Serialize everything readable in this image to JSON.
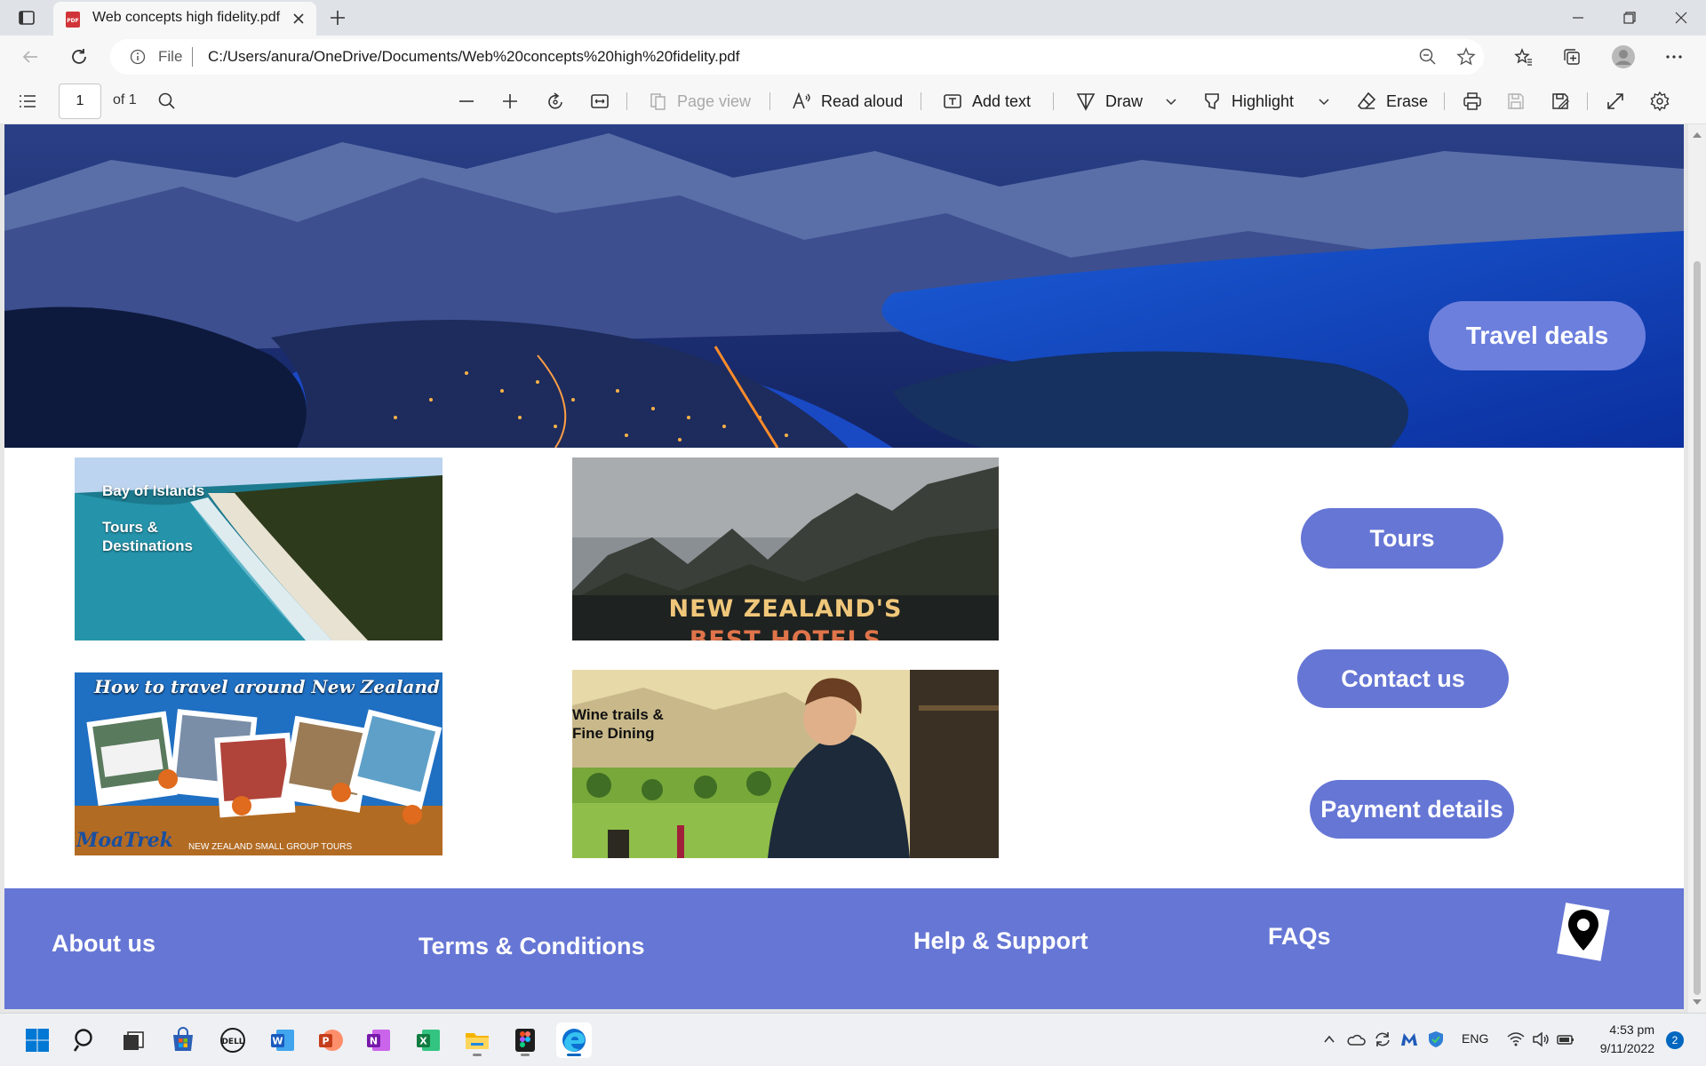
{
  "browser": {
    "tab": {
      "title": "Web concepts high fidelity.pdf",
      "favicon": "pdf-icon"
    },
    "address": {
      "scheme": "File",
      "url": "C:/Users/anura/OneDrive/Documents/Web%20concepts%20high%20fidelity.pdf"
    }
  },
  "pdf_toolbar": {
    "page_number": "1",
    "page_total": "of 1",
    "page_view": "Page view",
    "read_aloud": "Read aloud",
    "add_text": "Add text",
    "draw": "Draw",
    "highlight": "Highlight",
    "erase": "Erase"
  },
  "document": {
    "hero": {
      "button": "Travel deals"
    },
    "cards": {
      "bay_of_islands": {
        "line1": "Bay of Islands",
        "line2": "Tours &",
        "line3": "Destinations"
      },
      "hotels": {
        "line1": "NEW ZEALAND'S",
        "line2": "BEST HOTELS"
      },
      "travel": {
        "title": "How to travel around New Zealand",
        "brand": "MoaTrek",
        "tagline": "NEW ZEALAND SMALL GROUP TOURS"
      },
      "wine": {
        "line1": "Wine trails &",
        "line2": "Fine Dining"
      }
    },
    "side_buttons": {
      "tours": "Tours",
      "contact": "Contact us",
      "payment": "Payment details"
    },
    "footer": {
      "about": "About us",
      "terms": "Terms & Conditions",
      "help": "Help & Support",
      "faqs": "FAQs"
    },
    "colors": {
      "accent": "#6676d5",
      "hero_button": "#6c7fdd"
    }
  },
  "taskbar": {
    "apps": [
      "windows-start",
      "search",
      "task-view",
      "microsoft-store",
      "dell",
      "word",
      "powerpoint",
      "onenote",
      "excel",
      "file-explorer",
      "figma",
      "edge"
    ],
    "language": "ENG",
    "time": "4:53 pm",
    "date": "9/11/2022",
    "notifications": "2"
  }
}
